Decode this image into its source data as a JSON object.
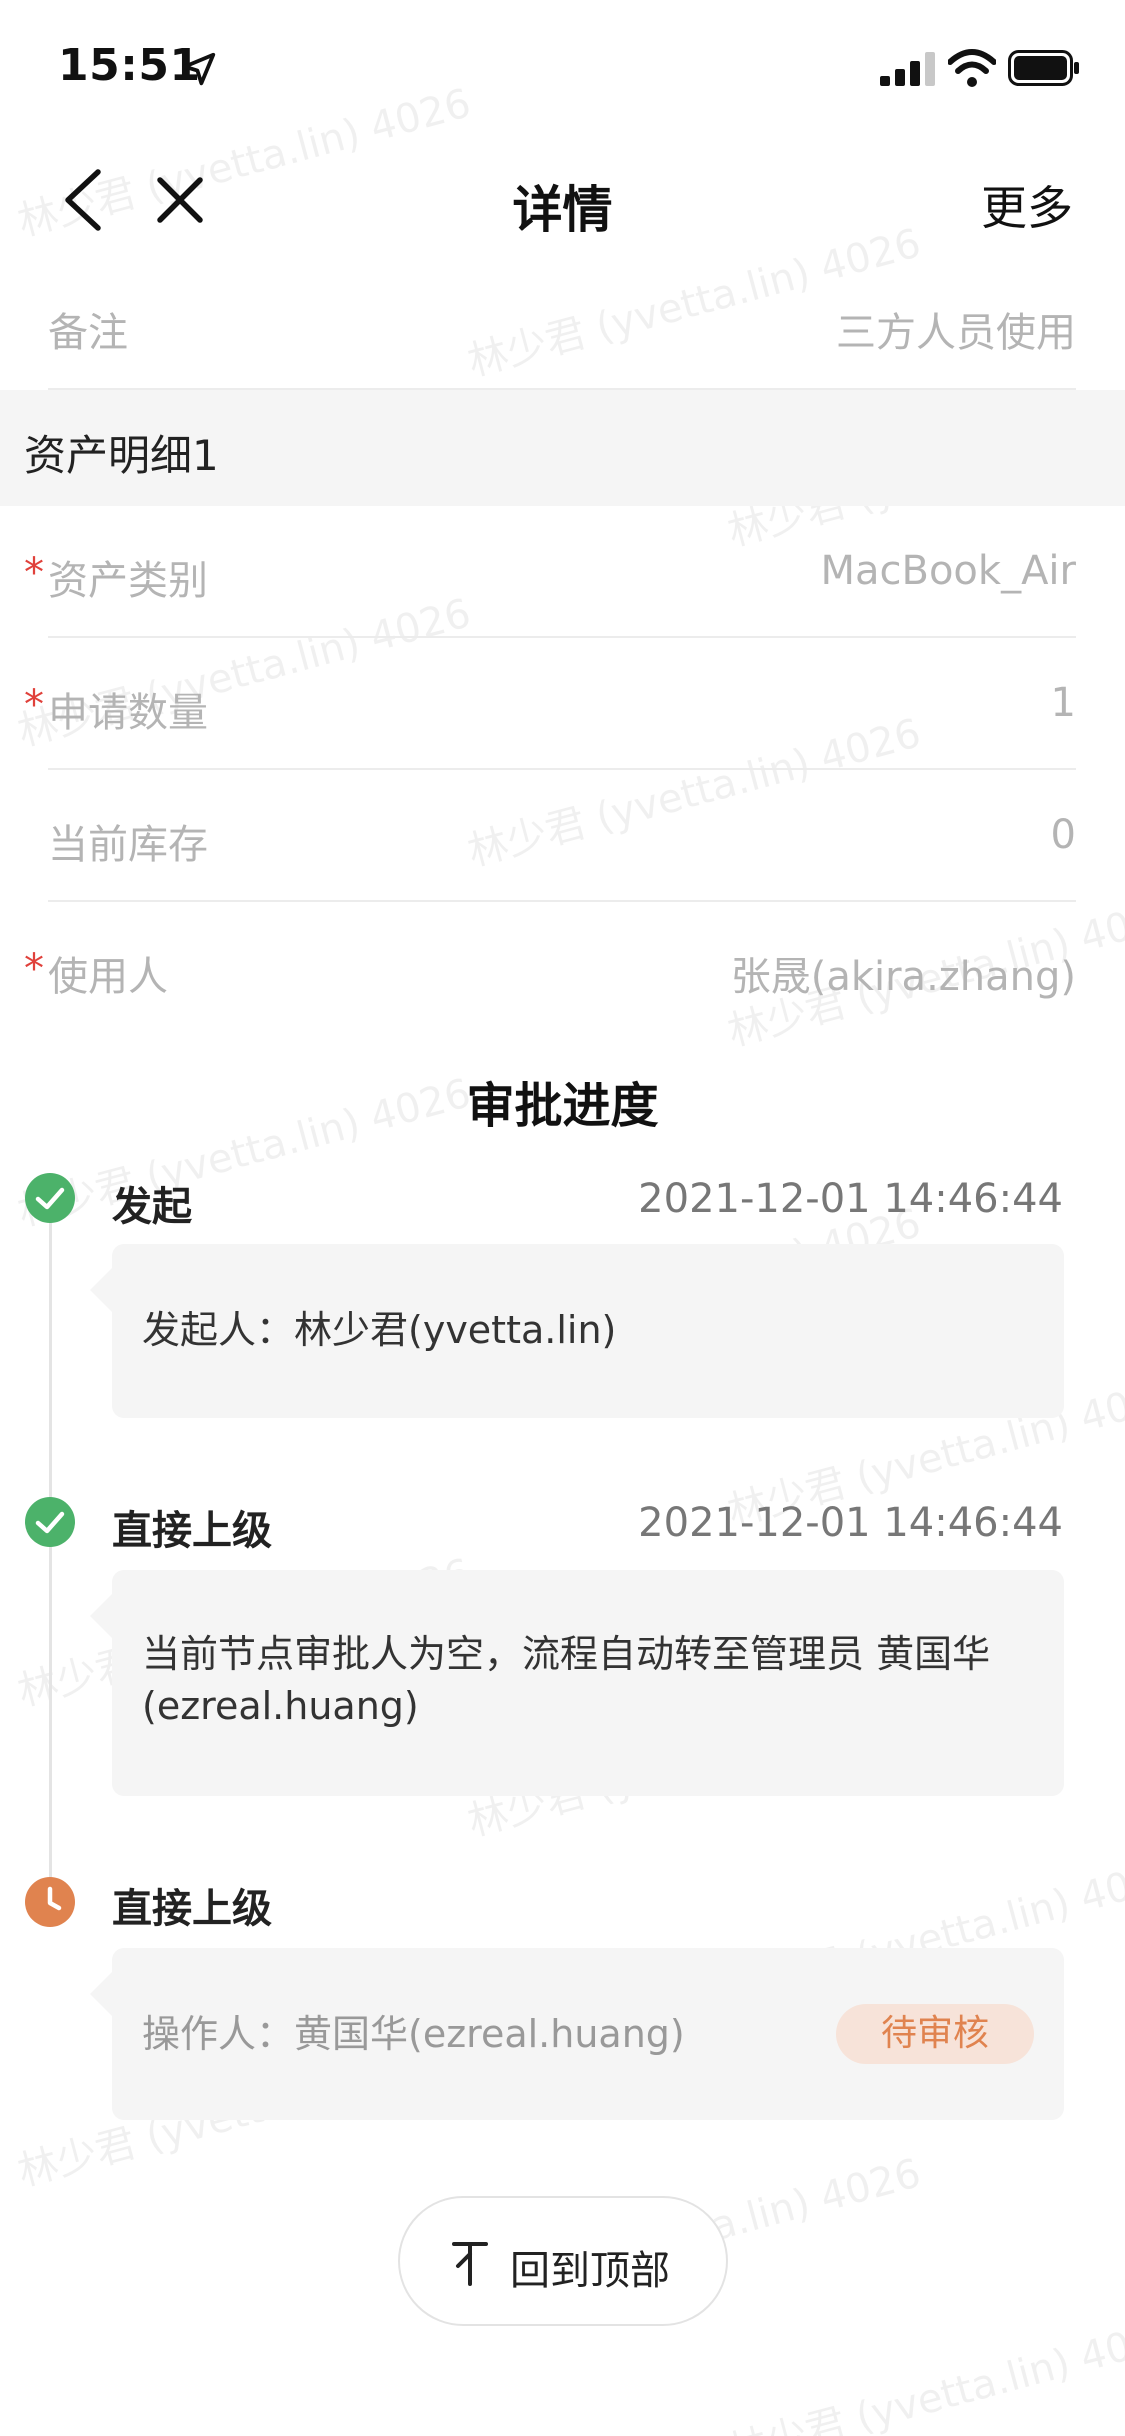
{
  "status_bar": {
    "time": "15:51"
  },
  "nav": {
    "title": "详情",
    "more_label": "更多"
  },
  "remark": {
    "label": "备注",
    "value": "三方人员使用"
  },
  "asset_section": {
    "title": "资产明细1",
    "required_mark": "*",
    "rows": [
      {
        "label": "资产类别",
        "value": "MacBook_Air"
      },
      {
        "label": "申请数量",
        "value": "1"
      },
      {
        "label": "当前库存",
        "value": "0"
      },
      {
        "label": "使用人",
        "value": "张晟(akira.zhang)"
      }
    ]
  },
  "approval": {
    "heading": "审批进度",
    "steps": [
      {
        "title": "发起",
        "time": "2021-12-01 14:46:44",
        "detail": "发起人：林少君(yvetta.lin)",
        "status": "done"
      },
      {
        "title": "直接上级",
        "time": "2021-12-01 14:46:44",
        "detail": "当前节点审批人为空，流程自动转至管理员 黄国华(ezreal.huang)",
        "status": "done"
      },
      {
        "title": "直接上级",
        "detail": "操作人：黄国华(ezreal.huang)",
        "status": "pending",
        "badge": "待审核"
      }
    ]
  },
  "back_to_top": {
    "label": "回到顶部"
  },
  "watermark": {
    "text": "林少君 (yvetta.lin) 4026"
  },
  "colors": {
    "done": "#4cb26a",
    "pending": "#e0834f",
    "required": "#e0413b"
  }
}
